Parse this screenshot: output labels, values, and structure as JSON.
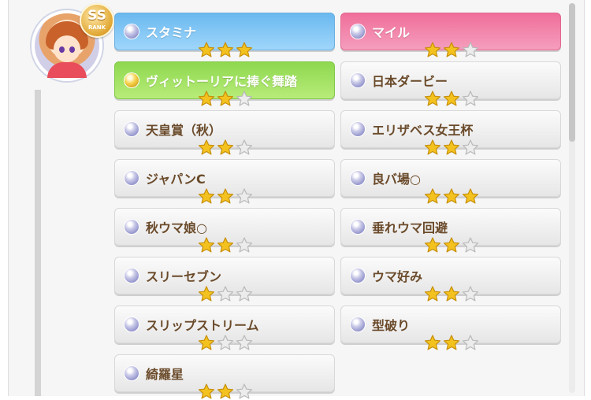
{
  "badge": {
    "rank_main": "SS",
    "rank_sub": "RANK"
  },
  "skills": [
    {
      "name": "スタミナ",
      "stars": 3,
      "style": "blue",
      "orb": "silver"
    },
    {
      "name": "マイル",
      "stars": 2,
      "style": "pink",
      "orb": "silver"
    },
    {
      "name": "ヴィットーリアに捧ぐ舞踏",
      "stars": 2,
      "style": "green",
      "orb": "gold"
    },
    {
      "name": "日本ダービー",
      "stars": 2,
      "style": "gray",
      "orb": "silver"
    },
    {
      "name": "天皇賞（秋）",
      "stars": 2,
      "style": "gray",
      "orb": "silver"
    },
    {
      "name": "エリザベス女王杯",
      "stars": 2,
      "style": "gray",
      "orb": "silver"
    },
    {
      "name": "ジャパンC",
      "stars": 2,
      "style": "gray",
      "orb": "silver"
    },
    {
      "name": "良バ場○",
      "stars": 3,
      "style": "gray",
      "orb": "silver"
    },
    {
      "name": "秋ウマ娘○",
      "stars": 2,
      "style": "gray",
      "orb": "silver"
    },
    {
      "name": "垂れウマ回避",
      "stars": 2,
      "style": "gray",
      "orb": "silver"
    },
    {
      "name": "スリーセブン",
      "stars": 1,
      "style": "gray",
      "orb": "silver"
    },
    {
      "name": "ウマ好み",
      "stars": 2,
      "style": "gray",
      "orb": "silver"
    },
    {
      "name": "スリップストリーム",
      "stars": 1,
      "style": "gray",
      "orb": "silver"
    },
    {
      "name": "型破り",
      "stars": 2,
      "style": "gray",
      "orb": "silver"
    },
    {
      "name": "綺羅星",
      "stars": 2,
      "style": "gray",
      "orb": "silver"
    }
  ],
  "colors": {
    "star_filled": "#f4c21f",
    "star_empty": "#ececec",
    "text_dark": "#6a4a2a"
  }
}
